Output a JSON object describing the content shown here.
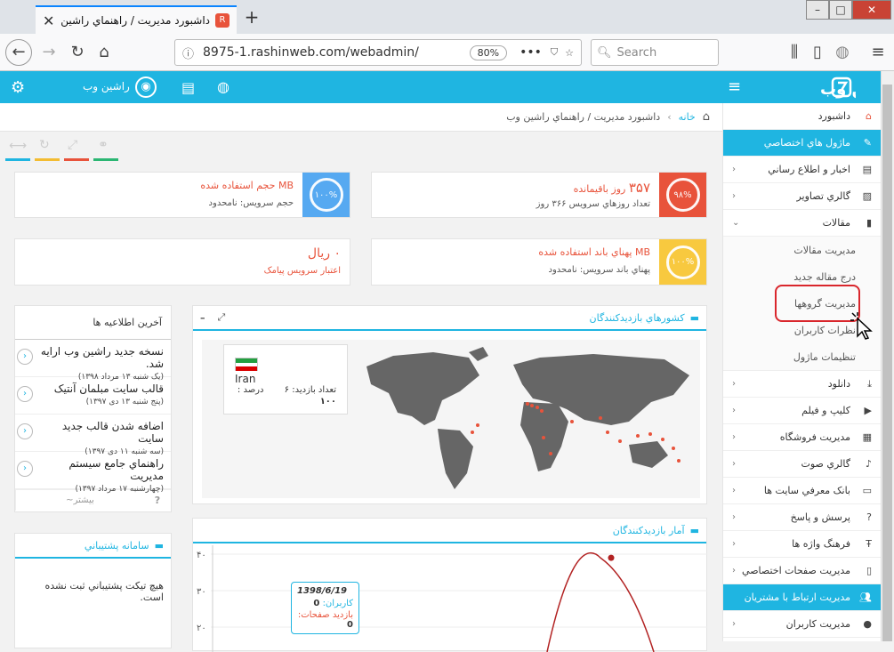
{
  "browser": {
    "tab_title": "داشبورد مديريت / راهنماي راشين وب",
    "url": "8975-1.rashinweb.com/webadmin/",
    "zoom": "80%",
    "search_placeholder": "Search"
  },
  "header": {
    "user_name": "راشين وب"
  },
  "breadcrumb": {
    "home": "خانه",
    "current": "داشبورد مديريت / راهنماي راشين وب"
  },
  "stats": {
    "storage": {
      "label": "MB حجم استفاده شده",
      "note": "حجم سرويس: نامحدود",
      "ring": "۱۰۰%"
    },
    "days": {
      "value": "۳۵۷",
      "unit": "روز باقيمانده",
      "note": "تعداد روزهاي سرويس ۳۶۶ روز",
      "ring": "۹۸%"
    },
    "sms": {
      "value": "۰ ريال",
      "note": "اعتبار سرويس پيامک"
    },
    "bandwidth": {
      "label": "MB پهناي باند استفاده شده",
      "note": "پهناي باند سرويس: نامحدود",
      "ring": "۱۰۰%"
    }
  },
  "countries_panel": {
    "title": "کشورهاي بازديدکنندگان",
    "country": "Iran",
    "visits_label": "تعداد بازديد:",
    "visits_value": "۶",
    "percent_label": "درصد :",
    "percent_value": "۱۰۰"
  },
  "news_panel": {
    "title": "آخرين اطلاعيه ها",
    "items": [
      {
        "title": "نسخه جديد راشين وب ارايه شد.",
        "date": "(يک شنبه ۱۳ مرداد ۱۳۹۸)"
      },
      {
        "title": "قالب سايت مبلمان آنتيک",
        "date": "(پنج شنبه ۱۳ دی ۱۳۹۷)"
      },
      {
        "title": "اضافه شدن قالب جديد سايت",
        "date": "(سه شنبه ۱۱ دی ۱۳۹۷)"
      },
      {
        "title": "راهنماي جامع سيستم مديريت",
        "date": "(چهارشنبه ۱۷ مرداد ۱۳۹۷)"
      }
    ],
    "more": "~بيشتر",
    "help": "?"
  },
  "support_panel": {
    "title": "سامانه پشتيباني",
    "empty": "هيچ تيکت پشتيباني ثبت نشده است."
  },
  "visits_panel": {
    "title": "آمار بازديدکنندگان"
  },
  "chart_data": {
    "type": "line",
    "y_ticks": [
      "۴۰",
      "۳۰",
      "۲۰"
    ],
    "visible_point_value": 39,
    "tooltip": {
      "date": "1398/6/19",
      "users_label": "کاربران:",
      "users_value": "0",
      "views_label": "بازديد صفحات:",
      "views_value": "0"
    },
    "line_color": "#b22222"
  },
  "sidebar": {
    "items": [
      {
        "label": "داشبورد",
        "icon": "home-icon",
        "arrow": false,
        "active": false
      },
      {
        "label": "ماژول هاي اختصاصي",
        "icon": "pencil-icon",
        "arrow": false,
        "active": true
      },
      {
        "label": "اخبار و اطلاع رساني",
        "icon": "news-icon",
        "arrow": true,
        "active": false
      },
      {
        "label": "گالري تصاوير",
        "icon": "image-icon",
        "arrow": true,
        "active": false
      },
      {
        "label": "مقالات",
        "icon": "document-icon",
        "arrow": "down",
        "active": false
      }
    ],
    "subitems": [
      "مديريت مقالات",
      "درج مقاله جديد",
      "مديريت گروهها",
      "نظرات کاربران",
      "تنظيمات ماژول"
    ],
    "items2": [
      {
        "label": "دانلود",
        "icon": "download-icon"
      },
      {
        "label": "کليپ و فيلم",
        "icon": "film-icon"
      },
      {
        "label": "مديريت فروشگاه",
        "icon": "cart-icon"
      },
      {
        "label": "گالري صوت",
        "icon": "music-icon"
      },
      {
        "label": "بانک معرفي سايت ها",
        "icon": "monitor-icon"
      },
      {
        "label": "پرسش و پاسخ",
        "icon": "question-icon"
      },
      {
        "label": "فرهنگ واژه ها",
        "icon": "text-icon"
      },
      {
        "label": "مديريت صفحات اختصاصي",
        "icon": "page-icon"
      }
    ],
    "section2": "مديريت ارتباط با مشتريان",
    "last_item": "مديريت کاربران"
  }
}
